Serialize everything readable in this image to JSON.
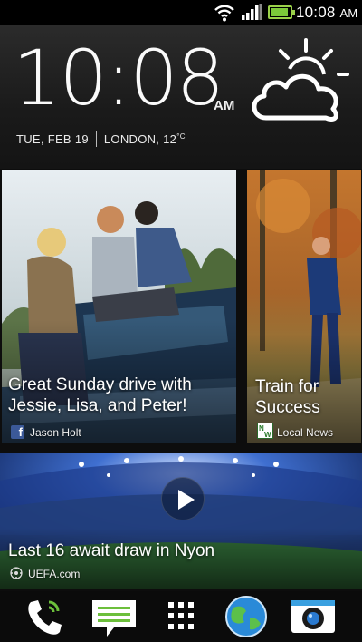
{
  "status_bar": {
    "time": "10:08",
    "ampm": "AM",
    "battery_level": 0.9,
    "wifi_icon": "wifi-icon",
    "signal_icon": "signal-icon",
    "battery_icon": "battery-icon"
  },
  "clock": {
    "time": "10:08",
    "ampm": "AM",
    "date": "TUE, FEB 19",
    "city": "LONDON, 12",
    "temp_unit": "°C",
    "weather_icon": "partly-cloudy-icon"
  },
  "feed": {
    "tiles": [
      {
        "title": "Great Sunday drive with Jessie, Lisa, and Peter!",
        "source": "Jason Holt",
        "source_icon": "facebook-icon"
      },
      {
        "title": "Train for Success",
        "source": "Local News",
        "source_icon": "local-news-icon"
      },
      {
        "title": "Last 16 await draw in Nyon",
        "source": "UEFA.com",
        "source_icon": "uefa-icon",
        "media_icon": "play-icon"
      }
    ]
  },
  "dock": {
    "items": [
      "phone-icon",
      "messages-icon",
      "app-drawer-icon",
      "browser-icon",
      "camera-icon"
    ]
  },
  "colors": {
    "battery": "#7cc93a",
    "phone_green": "#6cbf3b",
    "facebook": "#3b5998"
  }
}
